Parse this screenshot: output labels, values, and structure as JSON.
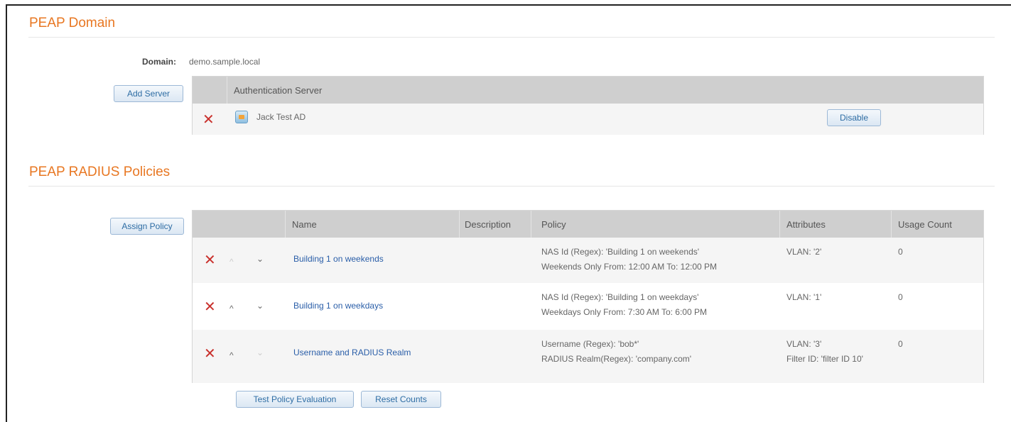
{
  "peap_domain": {
    "title": "PEAP Domain",
    "domain_label": "Domain:",
    "domain_value": "demo.sample.local",
    "add_server_label": "Add Server",
    "servers_table": {
      "header": "Authentication Server",
      "rows": [
        {
          "name": "Jack Test AD",
          "action_label": "Disable",
          "icon": "server-icon"
        }
      ]
    }
  },
  "radius_policies": {
    "title": "PEAP RADIUS Policies",
    "assign_policy_label": "Assign Policy",
    "columns": [
      "Name",
      "Description",
      "Policy",
      "Attributes",
      "Usage Count"
    ],
    "rows": [
      {
        "name": "Building 1 on weekends",
        "description": "",
        "policy_line1": "NAS Id (Regex): 'Building 1 on weekends'",
        "policy_line2": "Weekends Only From: 12:00 AM To: 12:00 PM",
        "attr_line1": "VLAN: '2'",
        "attr_line2": "",
        "usage_count": "0",
        "up_enabled": false,
        "down_enabled": true
      },
      {
        "name": "Building 1 on weekdays",
        "description": "",
        "policy_line1": "NAS Id (Regex): 'Building 1 on weekdays'",
        "policy_line2": "Weekdays Only From: 7:30 AM To: 6:00 PM",
        "attr_line1": "VLAN: '1'",
        "attr_line2": "",
        "usage_count": "0",
        "up_enabled": true,
        "down_enabled": true
      },
      {
        "name": "Username and RADIUS Realm",
        "description": "",
        "policy_line1": "Username (Regex): 'bob*'",
        "policy_line2": "RADIUS Realm(Regex): 'company.com'",
        "attr_line1": "VLAN: '3'",
        "attr_line2": "Filter ID: 'filter ID 10'",
        "usage_count": "0",
        "up_enabled": true,
        "down_enabled": false
      }
    ],
    "test_policy_label": "Test Policy Evaluation",
    "reset_counts_label": "Reset Counts"
  },
  "glyphs": {
    "delete": "✕",
    "up": "^",
    "down": "⌄"
  },
  "colors": {
    "accent": "#e87722",
    "link": "#2a5ea8",
    "delete": "#c9302c"
  }
}
